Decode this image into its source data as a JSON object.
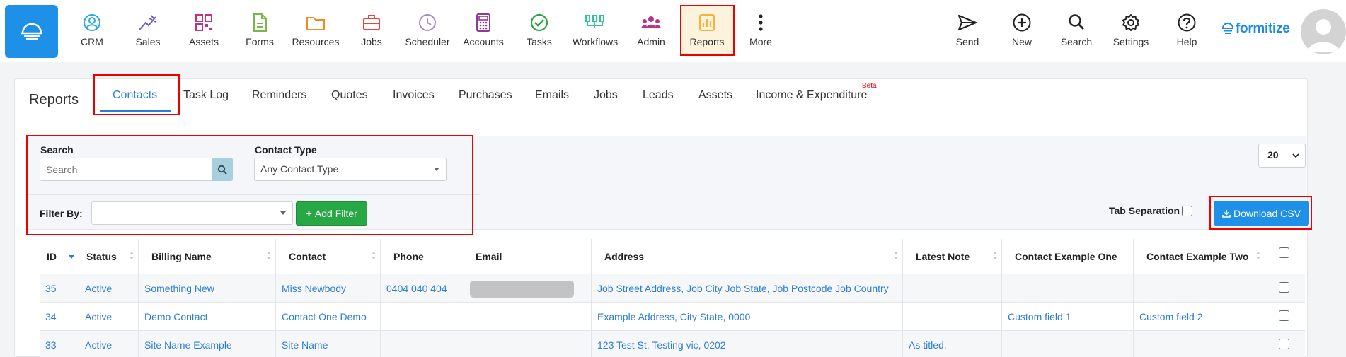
{
  "nav": {
    "items": [
      {
        "label": "CRM",
        "icon": "crm-icon",
        "color": "#29a7e0"
      },
      {
        "label": "Sales",
        "icon": "sales-icon",
        "color": "#6b5fd3"
      },
      {
        "label": "Assets",
        "icon": "assets-icon",
        "color": "#c2337e"
      },
      {
        "label": "Forms",
        "icon": "forms-icon",
        "color": "#7ab648"
      },
      {
        "label": "Resources",
        "icon": "resources-icon",
        "color": "#f08a24"
      },
      {
        "label": "Jobs",
        "icon": "jobs-icon",
        "color": "#e9443a"
      },
      {
        "label": "Scheduler",
        "icon": "scheduler-icon",
        "color": "#a48cc4"
      },
      {
        "label": "Accounts",
        "icon": "accounts-icon",
        "color": "#8d3a8f"
      },
      {
        "label": "Tasks",
        "icon": "tasks-icon",
        "color": "#28a745"
      },
      {
        "label": "Workflows",
        "icon": "workflows-icon",
        "color": "#2ec4a0"
      },
      {
        "label": "Admin",
        "icon": "admin-icon",
        "color": "#b8338c"
      },
      {
        "label": "Reports",
        "icon": "reports-icon",
        "color": "#f3b43a"
      },
      {
        "label": "More",
        "icon": "more-icon",
        "color": "#222222"
      }
    ],
    "right_items": [
      {
        "label": "Send",
        "icon": "send-icon"
      },
      {
        "label": "New",
        "icon": "new-icon"
      },
      {
        "label": "Search",
        "icon": "search-icon"
      },
      {
        "label": "Settings",
        "icon": "settings-icon"
      },
      {
        "label": "Help",
        "icon": "help-icon"
      }
    ],
    "brand": "formitize"
  },
  "page": {
    "title": "Reports",
    "tabs": [
      "Contacts",
      "Task Log",
      "Reminders",
      "Quotes",
      "Invoices",
      "Purchases",
      "Emails",
      "Jobs",
      "Leads",
      "Assets",
      "Income & Expenditure"
    ],
    "active_tab": "Contacts",
    "beta_label": "Beta"
  },
  "filters": {
    "search_label": "Search",
    "search_placeholder": "Search",
    "contact_type_label": "Contact Type",
    "contact_type_value": "Any Contact Type",
    "filter_by_label": "Filter By:",
    "filter_by_value": "",
    "add_filter_label": "Add Filter",
    "page_size": "20",
    "tab_separation_label": "Tab Separation",
    "download_csv_label": "Download CSV"
  },
  "table": {
    "columns": [
      "ID",
      "Status",
      "Billing Name",
      "Contact",
      "Phone",
      "Email",
      "Address",
      "Latest Note",
      "Contact Example One",
      "Contact Example Two"
    ],
    "rows": [
      {
        "id": "35",
        "status": "Active",
        "billing_name": "Something New",
        "contact": "Miss Newbody",
        "phone": "0404 040 404",
        "email_redacted": true,
        "address": "Job Street Address, Job City Job State, Job Postcode Job Country",
        "latest_note": "",
        "example_one": "",
        "example_two": ""
      },
      {
        "id": "34",
        "status": "Active",
        "billing_name": "Demo Contact",
        "contact": "Contact One Demo",
        "phone": "",
        "email_redacted": false,
        "address": "Example Address, City State, 0000",
        "latest_note": "",
        "example_one": "Custom field 1",
        "example_two": "Custom field 2"
      },
      {
        "id": "33",
        "status": "Active",
        "billing_name": "Site Name Example",
        "contact": "Site Name",
        "phone": "",
        "email_redacted": false,
        "address": "123 Test St, Testing vic, 0202",
        "latest_note": "As titled.",
        "example_one": "",
        "example_two": ""
      }
    ]
  },
  "colors": {
    "accent": "#2c7ed4",
    "primary_button": "#1e90e8",
    "success_button": "#28a745",
    "highlight_box": "#ee0000"
  }
}
